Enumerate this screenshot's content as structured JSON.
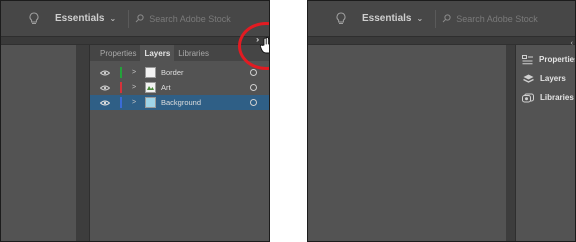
{
  "app": {
    "workspace_label": "Essentials",
    "search_placeholder": "Search Adobe Stock"
  },
  "panel_tabs": [
    "Properties",
    "Layers",
    "Libraries"
  ],
  "layers": [
    {
      "name": "Border",
      "color": "#23a23a",
      "selected": false
    },
    {
      "name": "Art",
      "color": "#d6323a",
      "selected": false
    },
    {
      "name": "Background",
      "color": "#3a6bd6",
      "selected": true
    }
  ],
  "dock_items": [
    {
      "label": "Properties",
      "icon": "properties-icon"
    },
    {
      "label": "Layers",
      "icon": "layers-icon"
    },
    {
      "label": "Libraries",
      "icon": "libraries-icon"
    }
  ],
  "colors": {
    "highlight_circle": "#e21b22",
    "selected_row": "#2f5f86"
  }
}
